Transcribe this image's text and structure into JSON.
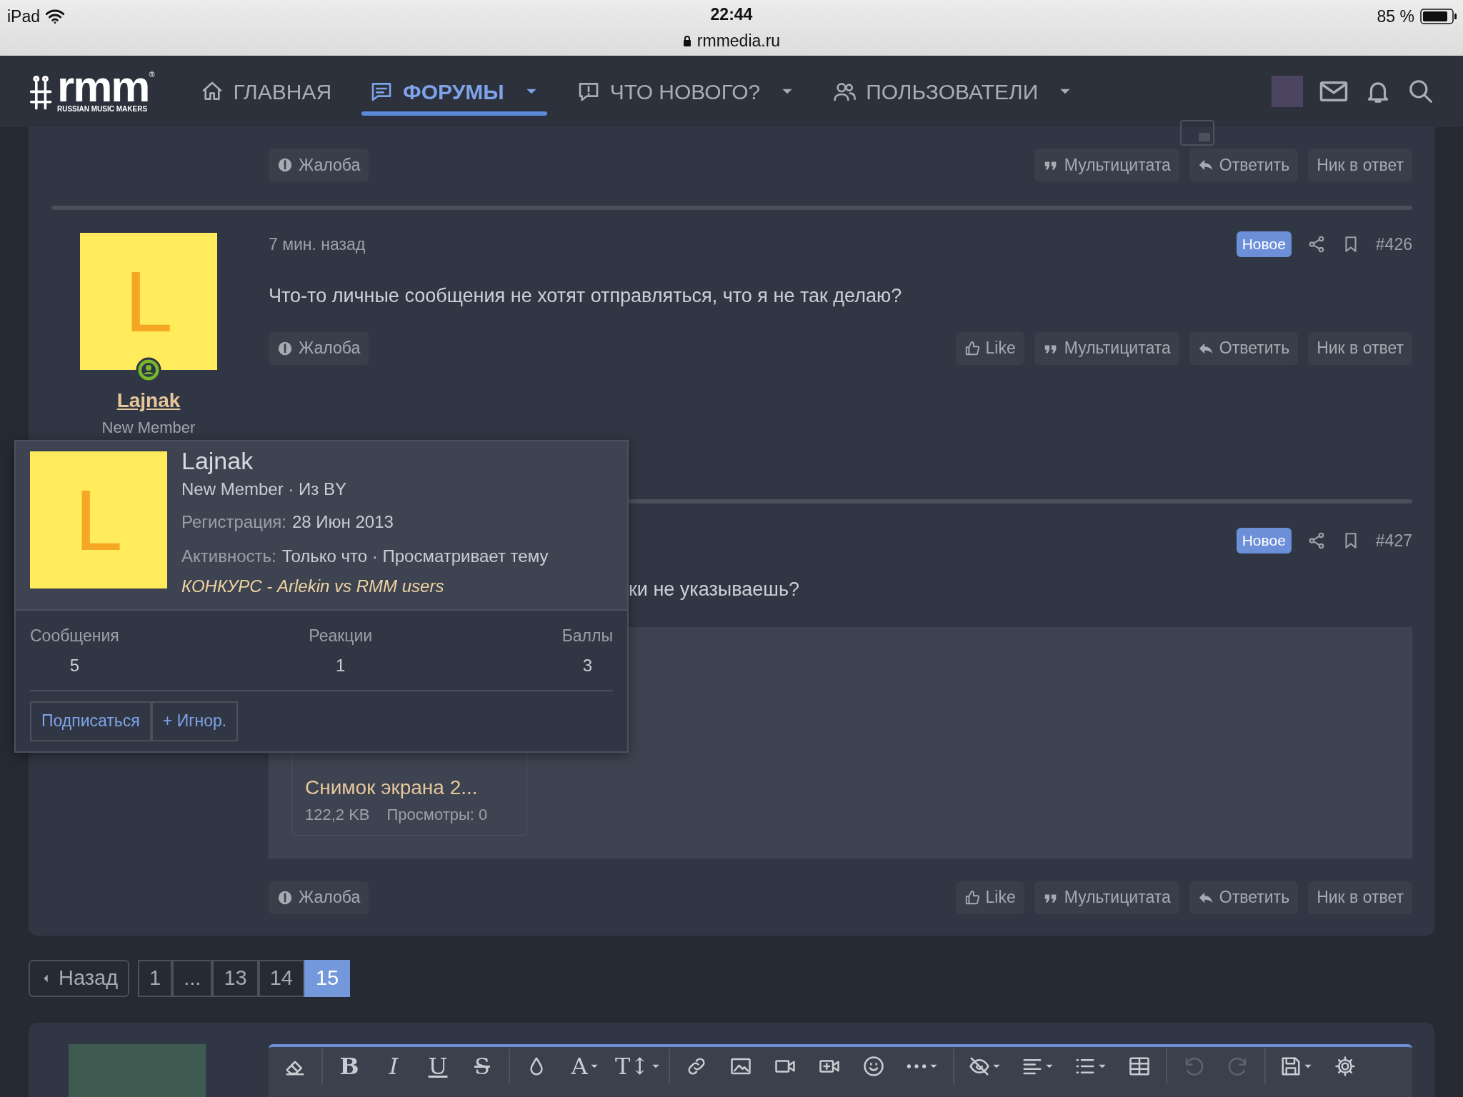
{
  "status_bar": {
    "device": "iPad",
    "time": "22:44",
    "url": "rmmedia.ru",
    "battery": "85 %"
  },
  "nav": {
    "logo": {
      "mark": "rmm",
      "registered": "®",
      "tagline": "RUSSIAN MUSIC MAKERS"
    },
    "items": [
      {
        "kind": "home",
        "label": "ГЛАВНАЯ",
        "selected": false,
        "has_menu": false
      },
      {
        "kind": "forums",
        "label": "ФОРУМЫ",
        "selected": true,
        "has_menu": true
      },
      {
        "kind": "whats_new",
        "label": "ЧТО НОВОГО?",
        "selected": false,
        "has_menu": true
      },
      {
        "kind": "members",
        "label": "ПОЛЬЗОВАТЕЛИ",
        "selected": false,
        "has_menu": true
      }
    ]
  },
  "previous_post": {
    "actions": [
      {
        "kind": "report",
        "label": "Жалоба"
      },
      {
        "kind": "multiquote",
        "label": "Мультицитата"
      },
      {
        "kind": "reply",
        "label": "Ответить"
      },
      {
        "kind": "mention",
        "label": "Ник в ответ"
      }
    ]
  },
  "posts": [
    {
      "user": {
        "name": "Lajnak",
        "initial": "L",
        "title": "New Member",
        "online": true
      },
      "time": "7 мин. назад",
      "badge": "Новое",
      "number": "#426",
      "message": "Что-то личные сообщения не хотят отправляться, что я не так делаю?",
      "actions": [
        {
          "kind": "report",
          "label": "Жалоба"
        },
        {
          "kind": "like",
          "label": "Like"
        },
        {
          "kind": "multiquote",
          "label": "Мультицитата"
        },
        {
          "kind": "reply",
          "label": "Ответить"
        },
        {
          "kind": "mention",
          "label": "Ник в ответ"
        }
      ]
    },
    {
      "badge": "Новое",
      "number": "#427",
      "message": "ки не указываешь?",
      "attachment": {
        "name": "Снимок экрана 2...",
        "size": "122,2 KB",
        "views": "Просмотры: 0"
      },
      "actions": [
        {
          "kind": "report",
          "label": "Жалоба"
        },
        {
          "kind": "like",
          "label": "Like"
        },
        {
          "kind": "multiquote",
          "label": "Мультицитата"
        },
        {
          "kind": "reply",
          "label": "Ответить"
        },
        {
          "kind": "mention",
          "label": "Ник в ответ"
        }
      ]
    }
  ],
  "member_card": {
    "name": "Lajnak",
    "initial": "L",
    "subtitle": "New Member · Из BY",
    "registered_label": "Регистрация:",
    "registered": "28 Июн 2013",
    "activity_label": "Активность:",
    "activity": "Только что · Просматривает тему",
    "activity_link": "КОНКУРС - Arlekin vs RMM users",
    "stats": [
      {
        "label": "Сообщения",
        "value": "5"
      },
      {
        "label": "Реакции",
        "value": "1"
      },
      {
        "label": "Баллы",
        "value": "3"
      }
    ],
    "buttons": [
      {
        "label": "Подписаться"
      },
      {
        "label": "+ Игнор."
      }
    ]
  },
  "pagination": {
    "prev": "Назад",
    "pages": [
      {
        "label": "1",
        "selected": false
      },
      {
        "label": "...",
        "selected": false
      },
      {
        "label": "13",
        "selected": false
      },
      {
        "label": "14",
        "selected": false
      },
      {
        "label": "15",
        "selected": true
      }
    ]
  },
  "editor": {
    "toolbar": [
      [
        {
          "kind": "eraser",
          "disabled": false
        }
      ],
      [
        {
          "kind": "bold",
          "glyph": "B",
          "disabled": false
        },
        {
          "kind": "italic",
          "glyph": "I",
          "disabled": false
        },
        {
          "kind": "underline",
          "glyph": "U",
          "disabled": false
        },
        {
          "kind": "strike",
          "glyph": "S",
          "disabled": false
        }
      ],
      [
        {
          "kind": "drop",
          "disabled": false
        },
        {
          "kind": "font",
          "glyph": "A",
          "disabled": false
        },
        {
          "kind": "text_size",
          "glyph": "T↕",
          "disabled": false
        }
      ],
      [
        {
          "kind": "link",
          "disabled": false
        },
        {
          "kind": "image",
          "disabled": false
        },
        {
          "kind": "video",
          "disabled": false
        },
        {
          "kind": "video_plus",
          "disabled": false
        },
        {
          "kind": "smiley",
          "disabled": false
        },
        {
          "kind": "more",
          "disabled": false
        }
      ],
      [
        {
          "kind": "hidden",
          "disabled": false
        },
        {
          "kind": "align",
          "disabled": false
        },
        {
          "kind": "list",
          "disabled": false
        },
        {
          "kind": "table",
          "disabled": false
        }
      ],
      [
        {
          "kind": "undo",
          "disabled": true
        },
        {
          "kind": "redo",
          "disabled": true
        }
      ],
      [
        {
          "kind": "save",
          "disabled": false
        },
        {
          "kind": "gear",
          "disabled": false
        }
      ]
    ]
  }
}
